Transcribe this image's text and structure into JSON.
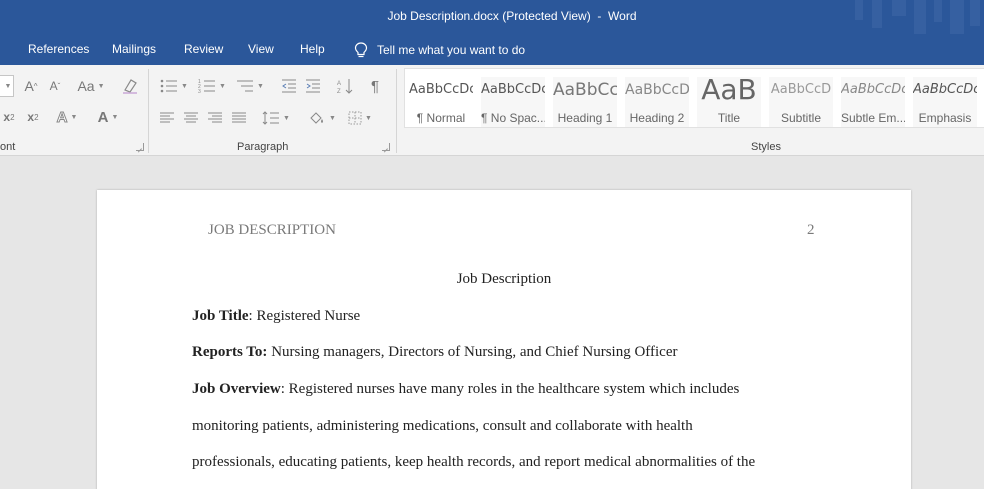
{
  "window": {
    "title": "Job Description.docx (Protected View)  -  Word"
  },
  "tabs": [
    "References",
    "Mailings",
    "Review",
    "View",
    "Help"
  ],
  "tell_me": {
    "text": "Tell me what you want to do",
    "icon": "lightbulb-icon"
  },
  "ribbon": {
    "groups": {
      "font": "ont",
      "paragraph": "Paragraph",
      "styles": "Styles"
    },
    "font_controls": {
      "grow": "A",
      "shrink": "A",
      "change_case": "Aa",
      "subscript": "x",
      "subscript_mark": "2",
      "superscript": "x",
      "superscript_mark": "2",
      "text_effects": "A",
      "font_color": "A"
    },
    "styles": [
      {
        "sample": "AaBbCcDc",
        "name": "¶ Normal"
      },
      {
        "sample": "AaBbCcDc",
        "name": "¶ No Spac..."
      },
      {
        "sample": "AaBbCc",
        "name": "Heading 1"
      },
      {
        "sample": "AaBbCcD",
        "name": "Heading 2"
      },
      {
        "sample": "AaB",
        "name": "Title"
      },
      {
        "sample": "AaBbCcD",
        "name": "Subtitle"
      },
      {
        "sample": "AaBbCcDc",
        "name": "Subtle Em..."
      },
      {
        "sample": "AaBbCcDc",
        "name": "Emphasis"
      }
    ]
  },
  "document": {
    "header_left": "JOB DESCRIPTION",
    "header_page": "2",
    "heading": "Job Description",
    "job_title": {
      "label": "Job Title",
      "value": ": Registered Nurse"
    },
    "reports_to": {
      "label": "Reports To:",
      "value": " Nursing managers, Directors of Nursing, and Chief Nursing Officer"
    },
    "overview": {
      "label": "Job Overview",
      "line1": ": Registered nurses have many roles in the healthcare system which includes",
      "line2": "monitoring patients, administering medications, consult and collaborate with health",
      "line3": "professionals, educating patients, keep health records, and report medical abnormalities of the"
    }
  }
}
